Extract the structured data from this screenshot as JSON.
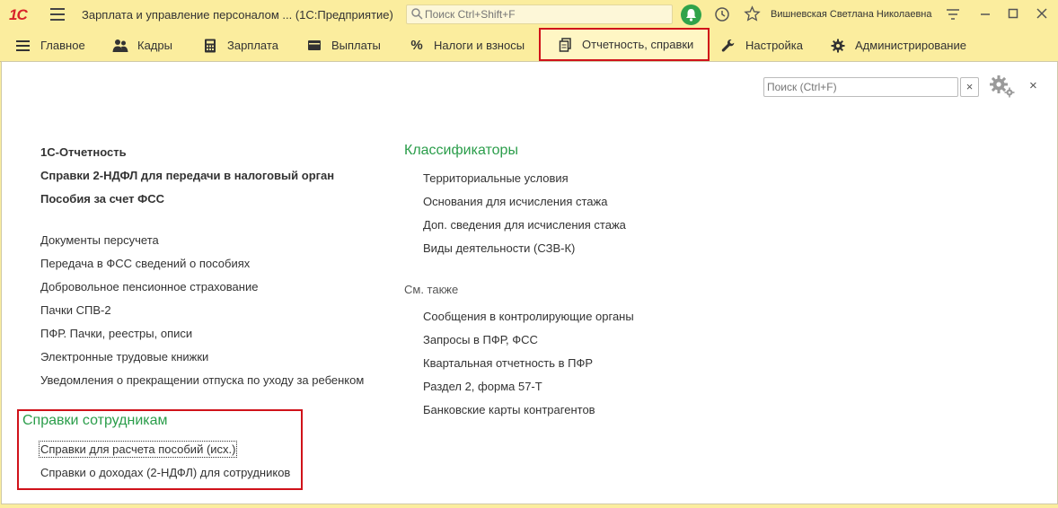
{
  "titlebar": {
    "logo": "1С",
    "app_title": "Зарплата и управление персоналом ...  (1С:Предприятие)",
    "search_placeholder": "Поиск Ctrl+Shift+F",
    "username": "Вишневская Светлана Николаевна"
  },
  "nav": [
    {
      "label": "Главное",
      "icon": "menu-lines-icon"
    },
    {
      "label": "Кадры",
      "icon": "people-icon"
    },
    {
      "label": "Зарплата",
      "icon": "calculator-icon"
    },
    {
      "label": "Выплаты",
      "icon": "wallet-icon"
    },
    {
      "label": "Налоги и взносы",
      "icon": "percent-icon"
    },
    {
      "label": "Отчетность, справки",
      "icon": "documents-icon",
      "active": true
    },
    {
      "label": "Настройка",
      "icon": "wrench-icon"
    },
    {
      "label": "Администрирование",
      "icon": "gear-icon"
    }
  ],
  "panel": {
    "search_placeholder": "Поиск (Ctrl+F)",
    "clear_label": "×",
    "close_label": "×"
  },
  "left": {
    "bold_links": [
      "1С-Отчетность",
      "Справки 2-НДФЛ для передачи в налоговый орган",
      "Пособия за счет ФСС"
    ],
    "links": [
      "Документы персучета",
      "Передача в ФСС сведений о пособиях",
      "Добровольное пенсионное страхование",
      "Пачки СПВ-2",
      "ПФР. Пачки, реестры, описи",
      "Электронные трудовые книжки",
      "Уведомления о прекращении отпуска по уходу за ребенком"
    ],
    "employee_section": {
      "title": "Справки сотрудникам",
      "links": [
        "Справки для расчета пособий (исх.)",
        "Справки о доходах (2-НДФЛ) для сотрудников"
      ]
    }
  },
  "right": {
    "classifiers_title": "Классификаторы",
    "classifiers": [
      "Территориальные условия",
      "Основания для исчисления стажа",
      "Доп. сведения для исчисления стажа",
      "Виды деятельности (СЗВ-К)"
    ],
    "see_also_title": "См. также",
    "see_also": [
      "Сообщения в контролирующие органы",
      "Запросы в ПФР, ФСС",
      "Квартальная отчетность в ПФР",
      "Раздел 2, форма 57-Т",
      "Банковские карты контрагентов"
    ]
  },
  "colors": {
    "toolbar_bg": "#fbed9e",
    "section_heading": "#2a9d4a",
    "highlight_box": "#d0121a",
    "bell": "#2fa34a"
  }
}
